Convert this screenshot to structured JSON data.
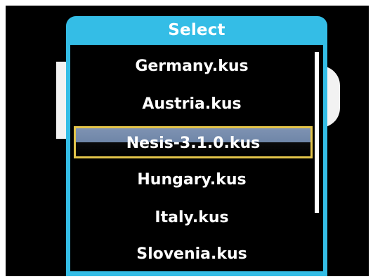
{
  "dialog": {
    "title": "Select",
    "items": [
      {
        "label": "Germany.kus",
        "selected": false
      },
      {
        "label": "Austria.kus",
        "selected": false
      },
      {
        "label": "Nesis-3.1.0.kus",
        "selected": true
      },
      {
        "label": "Hungary.kus",
        "selected": false
      },
      {
        "label": "Italy.kus",
        "selected": false
      },
      {
        "label": "Slovenia.kus",
        "selected": false
      }
    ],
    "scroll_position_fraction": 0.0,
    "scroll_visible_fraction": 0.76
  },
  "colors": {
    "frame": "#34bde6",
    "selection_border": "#e3c44a",
    "selection_fill": "#7e92b2",
    "text": "#ffffff",
    "background": "#000000"
  }
}
